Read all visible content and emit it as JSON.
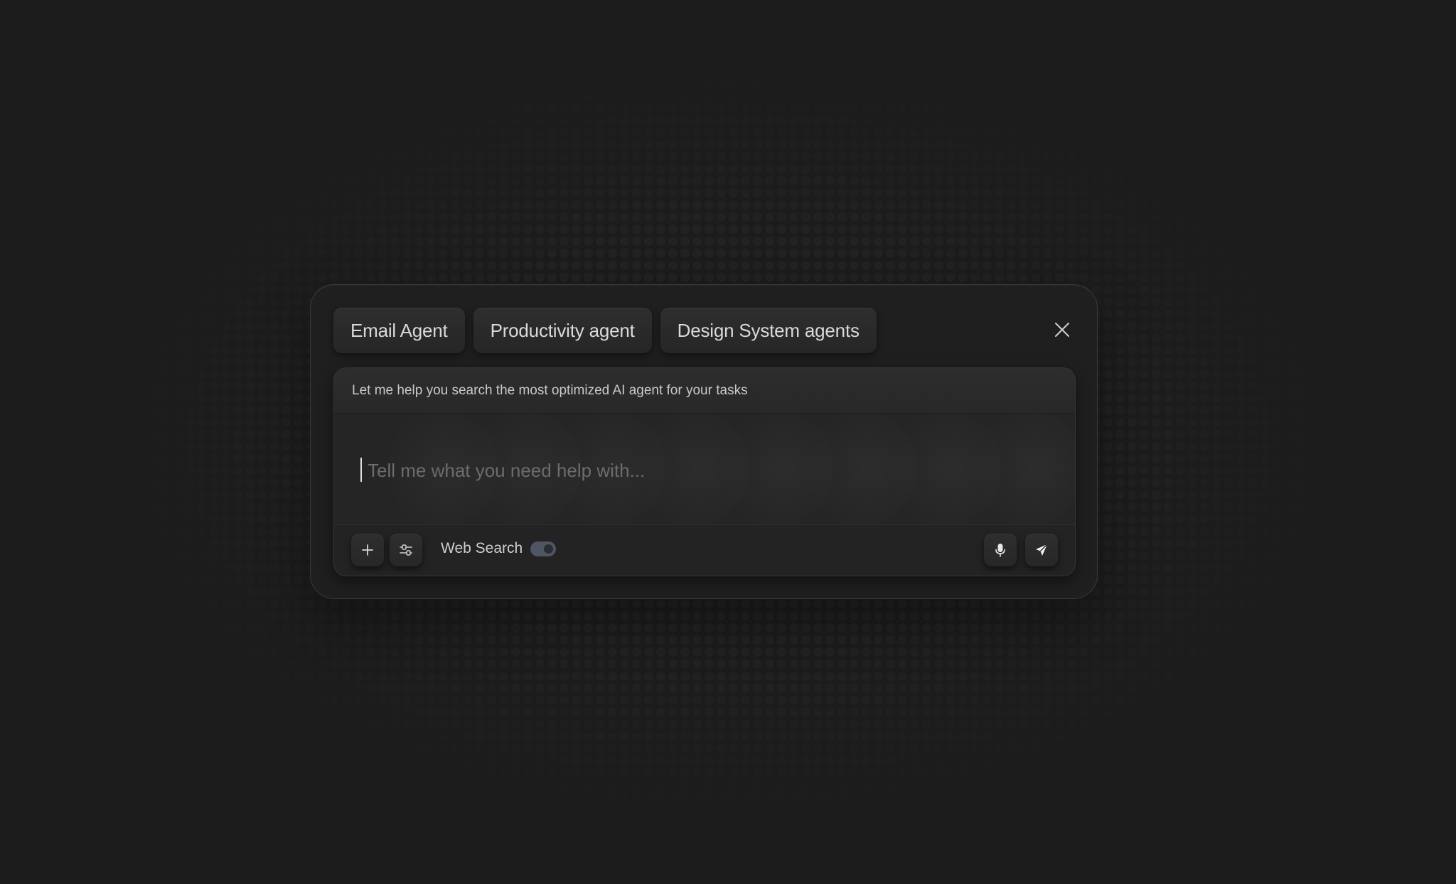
{
  "tabs": [
    {
      "label": "Email Agent"
    },
    {
      "label": "Productivity agent"
    },
    {
      "label": "Design System agents"
    }
  ],
  "panel": {
    "header_text": "Let me help you search the most optimized AI agent for your tasks",
    "input_placeholder": "Tell me what you need help with...",
    "input_value": ""
  },
  "toolbar": {
    "web_search_label": "Web Search",
    "web_search_enabled": true
  },
  "icons": {
    "close": "close-icon",
    "add": "plus-icon",
    "settings": "sliders-icon",
    "mic": "microphone-icon",
    "send": "send-icon"
  },
  "colors": {
    "background": "#1c1c1c",
    "card": "#1f1f1f",
    "toggle_track": "#4f5663"
  }
}
